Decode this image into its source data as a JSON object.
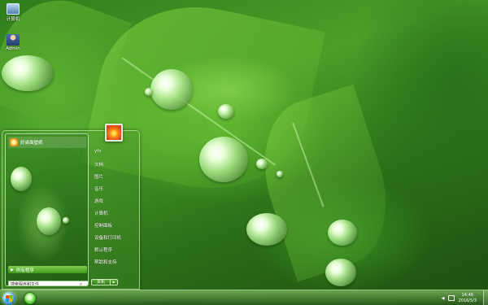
{
  "desktop": {
    "icons": [
      {
        "label": "计算机",
        "icon": "computer-icon"
      },
      {
        "label": "Admin",
        "icon": "user-folder-icon"
      }
    ]
  },
  "start_menu": {
    "recent_item": {
      "label": "好桌面壁纸",
      "icon": "wallpaper-app-icon"
    },
    "all_programs": "所有程序",
    "search_placeholder": "搜索程序和文件",
    "right_items": [
      "yfx",
      "文档",
      "图片",
      "音乐",
      "游戏",
      "计算机",
      "控制面板",
      "设备和打印机",
      "默认程序",
      "帮助和支持"
    ],
    "shutdown_label": "关机"
  },
  "taskbar": {
    "time": "14:46",
    "date": "2016/5/3"
  },
  "colors": {
    "accent": "#3f9a1e",
    "taskbar": "#2f6f1c"
  }
}
